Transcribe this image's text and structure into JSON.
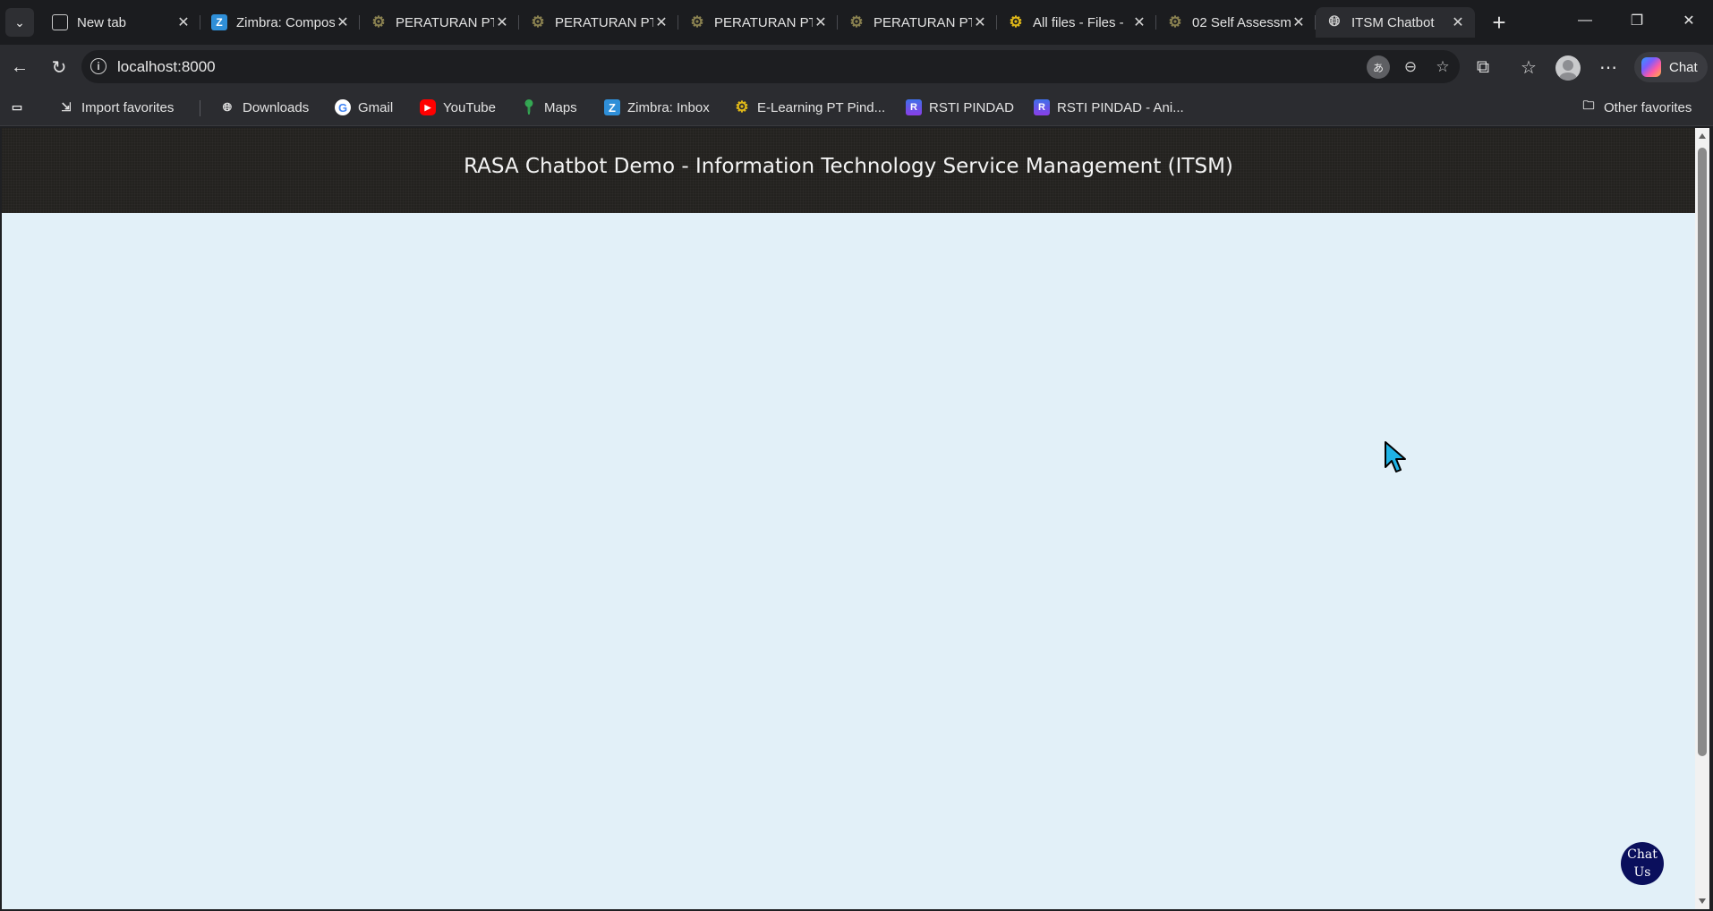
{
  "browser": {
    "tabs": [
      {
        "title": "New tab",
        "icon": "newtab-icon",
        "active": false
      },
      {
        "title": "Zimbra: Compos",
        "icon": "zimbra-icon",
        "active": false
      },
      {
        "title": "PERATURAN PT",
        "icon": "gear-icon",
        "active": false
      },
      {
        "title": "PERATURAN PT",
        "icon": "gear-icon",
        "active": false
      },
      {
        "title": "PERATURAN PT",
        "icon": "gear-icon",
        "active": false
      },
      {
        "title": "PERATURAN PT",
        "icon": "gear-icon",
        "active": false
      },
      {
        "title": "All files - Files - ",
        "icon": "gear-icon",
        "active": false
      },
      {
        "title": "02 Self Assessm",
        "icon": "gear-icon",
        "active": false
      },
      {
        "title": "ITSM Chatbot",
        "icon": "globe-icon",
        "active": true
      }
    ],
    "address": {
      "url": "localhost:8000"
    },
    "copilot_label": "Chat",
    "bookmarks": [
      {
        "label": "Import favorites",
        "icon": "import-icon"
      },
      {
        "label": "Downloads",
        "icon": "globe-icon"
      },
      {
        "label": "Gmail",
        "icon": "google-icon"
      },
      {
        "label": "YouTube",
        "icon": "youtube-icon"
      },
      {
        "label": "Maps",
        "icon": "maps-icon"
      },
      {
        "label": "Zimbra: Inbox",
        "icon": "zimbra-icon"
      },
      {
        "label": "E-Learning PT Pind...",
        "icon": "gear-icon"
      },
      {
        "label": "RSTI PINDAD",
        "icon": "rsti-icon"
      },
      {
        "label": "RSTI PINDAD - Ani...",
        "icon": "rsti-icon"
      }
    ],
    "other_favorites": "Other favorites"
  },
  "page": {
    "title": "RASA Chatbot Demo - Information Technology Service Management (ITSM)",
    "chat_widget": {
      "line1": "Chat",
      "line2": "Us"
    }
  }
}
